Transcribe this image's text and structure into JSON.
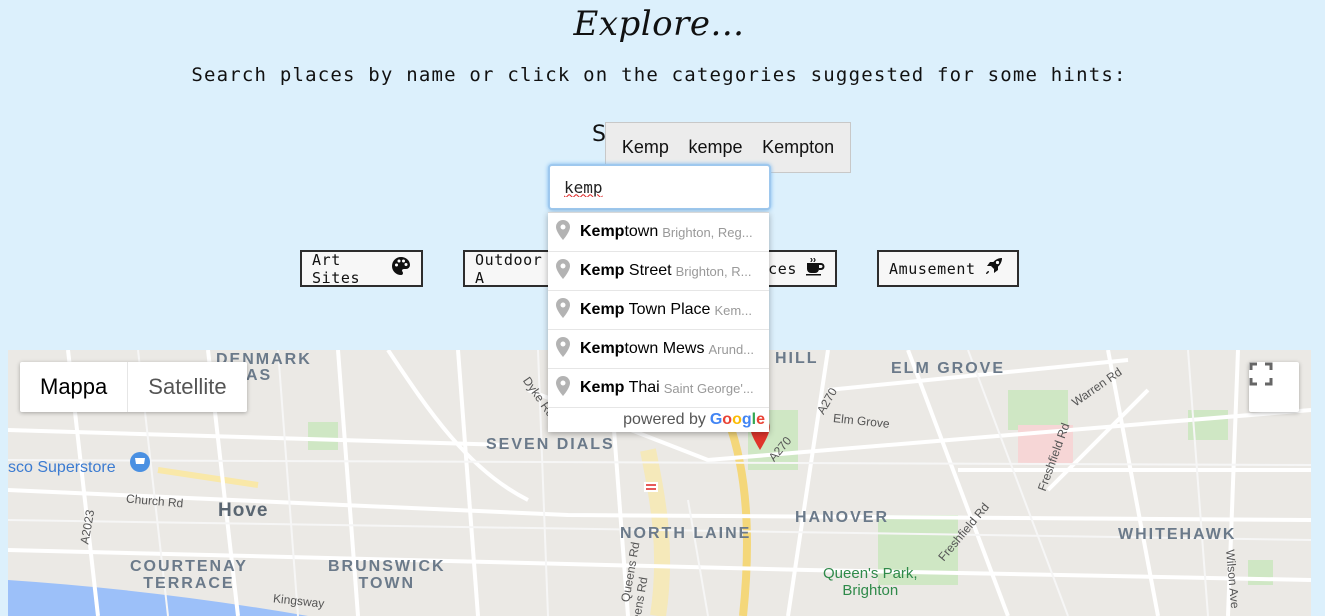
{
  "header": {
    "title": "Explore...",
    "subtitle": "Search places by name or click on the categories suggested for some hints:",
    "search_label": "S"
  },
  "spellcheck": {
    "suggestions": [
      "Kemp",
      "kempe",
      "Kempton"
    ]
  },
  "search": {
    "value": "kemp"
  },
  "categories": [
    {
      "label": "Art Sites",
      "icon": "palette-icon"
    },
    {
      "label": "Outdoor A",
      "icon": ""
    },
    {
      "label": "aces",
      "icon": "coffee-icon"
    },
    {
      "label": "Amusement",
      "icon": "rocket-icon"
    }
  ],
  "autocomplete": {
    "items": [
      {
        "bold": "Kemp",
        "rest": "town",
        "secondary": "Brighton, Reg..."
      },
      {
        "bold": "Kemp",
        "rest": " Street",
        "secondary": "Brighton, R..."
      },
      {
        "bold": "Kemp",
        "rest": " Town Place",
        "secondary": "Kem..."
      },
      {
        "bold": "Kemp",
        "rest": "town Mews",
        "secondary": "Arund..."
      },
      {
        "bold": "Kemp",
        "rest": " Thai",
        "secondary": "Saint George'..."
      }
    ],
    "footer": "powered by",
    "brand": "Google"
  },
  "map": {
    "map_type": {
      "active": "Mappa",
      "inactive": "Satellite"
    },
    "labels": {
      "denmark_villas": "DENMARK\nILLAS",
      "seven_dials": "SEVEN DIALS",
      "hove": "Hove",
      "courtenay_terrace": "COURTENAY\nTERRACE",
      "brunswick_town": "BRUNSWICK\nTOWN",
      "north_laine": "NORTH LAINE",
      "hanover": "HANOVER",
      "whitehawk": "WHITEHAWK",
      "elm_grove": "ELM GROVE",
      "hill": "HILL",
      "queens_park": "Queen's Park,\nBrighton",
      "superstore": "sco Superstore",
      "church_rd": "Church Rd",
      "kingsway": "Kingsway",
      "dyke_rd": "Dyke Rd",
      "a2023": "A2023",
      "a270_1": "A270",
      "a270_2": "A270",
      "elm_grove_rd": "Elm Grove",
      "warren_rd": "Warren Rd",
      "freshfield_rd": "Freshfield Rd",
      "freshfield_rd2": "Freshfield Rd",
      "queens_rd": "Queens Rd",
      "queens_rd2": "Queens Rd",
      "wilson_ave": "Wilson Ave"
    }
  },
  "colors": {
    "background": "#dcf0fc",
    "pin_red": "#e0352b",
    "map_green": "#cfe7c4"
  }
}
